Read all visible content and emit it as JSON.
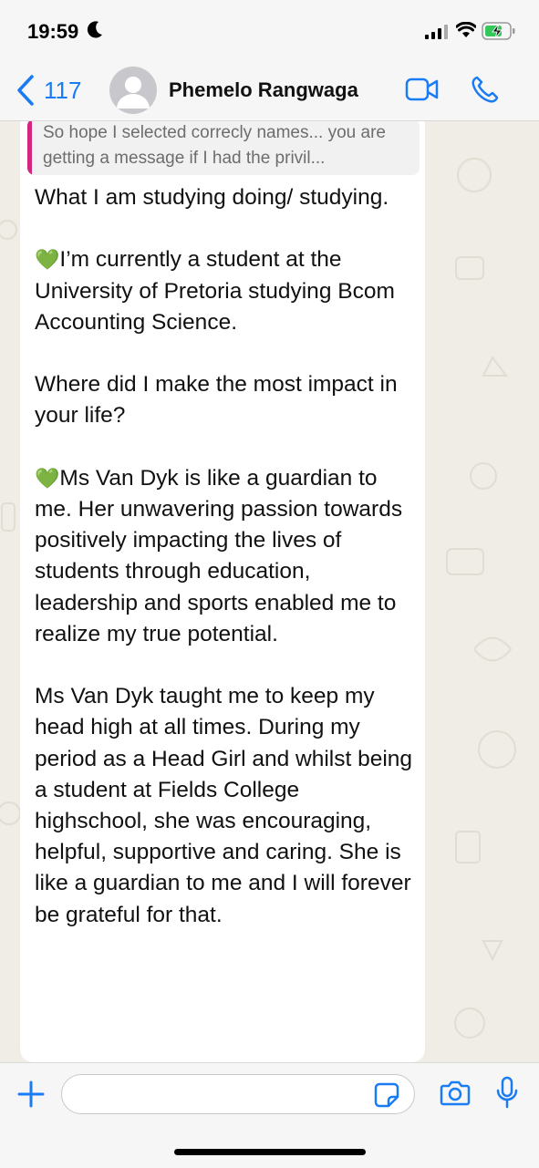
{
  "status_bar": {
    "time": "19:59",
    "icons": [
      "moon-icon",
      "signal-icon",
      "wifi-icon",
      "battery-charging-icon"
    ]
  },
  "header": {
    "back_count": "117",
    "contact_name": "Phemelo Rangwaga",
    "accent_color": "#1a7cf5"
  },
  "quoted": {
    "text": "So hope I selected correcly names... you are getting a message if I had the privil...",
    "bar_color": "#d4267f"
  },
  "message": {
    "paragraphs": [
      {
        "heart": "",
        "text": "What I am studying doing/ studying."
      },
      {
        "heart": "💚",
        "text": "I’m currently a student at the University of Pretoria studying Bcom Accounting Science."
      },
      {
        "heart": "",
        "text": "Where did I make the most impact in your life?"
      },
      {
        "heart": "💚",
        "text": "Ms Van Dyk is like a guardian to me. Her unwavering passion towards positively impacting the lives of students through education, leadership and sports enabled me to realize my true potential."
      },
      {
        "heart": "",
        "text": "Ms Van Dyk taught me to keep my head high at all times. During my period as a Head Girl and whilst being a student at Fields College highschool, she was encouraging, helpful, supportive and caring. She is like a guardian to me and I will forever be grateful for that."
      }
    ]
  },
  "composer": {
    "input_value": "",
    "icons": [
      "plus-icon",
      "sticker-icon",
      "camera-icon",
      "microphone-icon"
    ]
  }
}
